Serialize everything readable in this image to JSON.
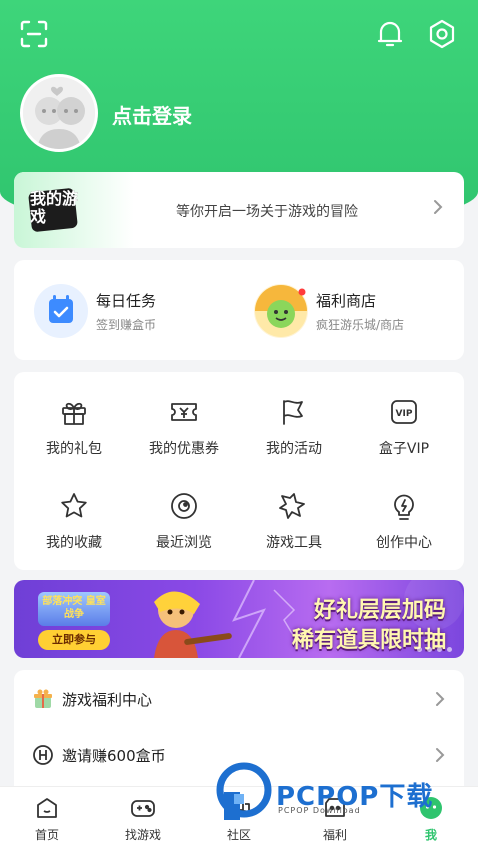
{
  "header": {
    "login_label": "点击登录",
    "scan_icon": "scan-icon",
    "bell_icon": "bell-icon",
    "settings_icon": "hexagon-settings-icon",
    "accent_color": "#2fc46e"
  },
  "banner": {
    "logo_text": "我的游戏",
    "text": "等你开启一场关于游戏的冒险"
  },
  "tasks": [
    {
      "title": "每日任务",
      "subtitle": "签到赚盒币"
    },
    {
      "title": "福利商店",
      "subtitle": "疯狂游乐城/商店"
    }
  ],
  "grid": [
    {
      "label": "我的礼包",
      "icon": "gift-icon"
    },
    {
      "label": "我的优惠券",
      "icon": "coupon-icon"
    },
    {
      "label": "我的活动",
      "icon": "flag-icon"
    },
    {
      "label": "盒子VIP",
      "icon": "vip-icon"
    },
    {
      "label": "我的收藏",
      "icon": "star-icon"
    },
    {
      "label": "最近浏览",
      "icon": "eye-icon"
    },
    {
      "label": "游戏工具",
      "icon": "tools-icon"
    },
    {
      "label": "创作中心",
      "icon": "bulb-icon"
    }
  ],
  "promo": {
    "badge": "部落冲突 皇室战争",
    "join": "立即参与",
    "line1": "好礼层层加码",
    "line2": "稀有道具限时抽"
  },
  "list": [
    {
      "label": "游戏福利中心",
      "icon": "gift-box-icon"
    },
    {
      "label": "邀请赚600盒币",
      "icon": "h-coin-icon"
    }
  ],
  "tabs": [
    {
      "label": "首页",
      "icon": "home-icon"
    },
    {
      "label": "找游戏",
      "icon": "gamepad-icon"
    },
    {
      "label": "社区",
      "icon": "community-icon"
    },
    {
      "label": "福利",
      "icon": "welfare-icon"
    },
    {
      "label": "我",
      "icon": "me-icon",
      "active": true
    }
  ],
  "watermark": {
    "text": "PCPOP下载",
    "sub": "PCPOP Download"
  }
}
